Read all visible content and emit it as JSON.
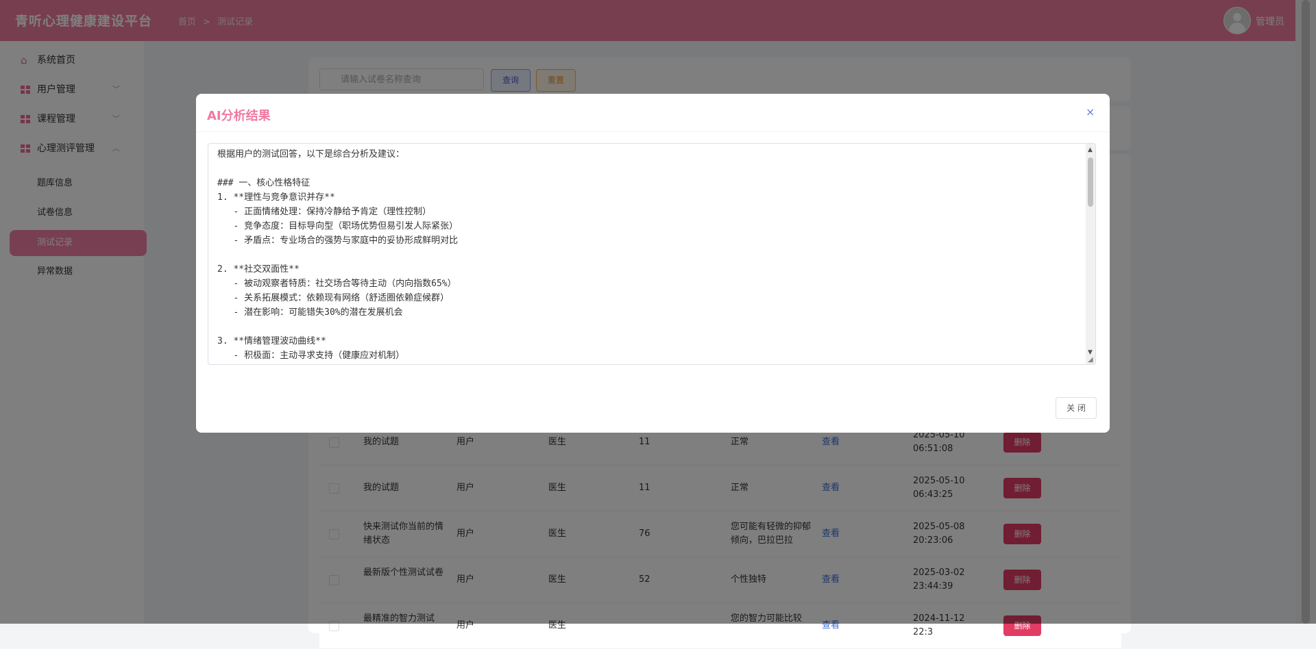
{
  "header": {
    "brand": "青听心理健康建设平台",
    "breadcrumb": [
      "首页",
      "测试记录"
    ],
    "user_name": "管理员"
  },
  "sidebar": {
    "items": [
      {
        "label": "系统首页",
        "icon": "home-icon"
      },
      {
        "label": "用户管理",
        "icon": "grid-icon",
        "chevron": "﹀"
      },
      {
        "label": "课程管理",
        "icon": "grid-icon",
        "chevron": "﹀"
      },
      {
        "label": "心理测评管理",
        "icon": "grid-icon",
        "chevron": "︿"
      }
    ],
    "sub_items": [
      {
        "label": "题库信息"
      },
      {
        "label": "试卷信息"
      },
      {
        "label": "测试记录",
        "active": true
      },
      {
        "label": "异常数据"
      }
    ]
  },
  "search": {
    "placeholder": "请输入试卷名称查询",
    "query_label": "查询",
    "reset_label": "重置"
  },
  "table": {
    "rows": [
      {
        "name": "我的试题",
        "user": "用户",
        "doctor": "医生",
        "score": "11",
        "result": "正常",
        "view": "查看",
        "time": "2025-05-10 06:51:08",
        "delete": "删除"
      },
      {
        "name": "我的试题",
        "user": "用户",
        "doctor": "医生",
        "score": "11",
        "result": "正常",
        "view": "查看",
        "time": "2025-05-10 06:43:25",
        "delete": "删除"
      },
      {
        "name": "快来测试你当前的情绪状态",
        "user": "用户",
        "doctor": "医生",
        "score": "76",
        "result": "您可能有轻微的抑郁倾向，巴拉巴拉",
        "view": "查看",
        "time": "2025-05-08 20:23:06",
        "delete": "删除"
      },
      {
        "name": "最新版个性测试试卷",
        "user": "用户",
        "doctor": "医生",
        "score": "52",
        "result": "个性独特",
        "view": "查看",
        "time": "2025-03-02 23:44:39",
        "delete": "删除"
      },
      {
        "name": "最精准的智力测试",
        "user": "用户",
        "doctor": "医生",
        "score": "",
        "result": "您的智力可能比较",
        "view": "查看",
        "time": "2024-11-12 22:3",
        "delete": "删除"
      }
    ]
  },
  "modal": {
    "title": "AI分析结果",
    "close_icon": "×",
    "content": "根据用户的测试回答，以下是综合分析及建议：\n\n### 一、核心性格特征\n1. **理性与竞争意识并存**\n   - 正面情绪处理：保持冷静给予肯定（理性控制）\n   - 竞争态度：目标导向型（职场优势但易引发人际紧张）\n   - 矛盾点：专业场合的强势与家庭中的妥协形成鲜明对比\n\n2. **社交双面性**\n   - 被动观察者特质：社交场合等待主动（内向指数65%）\n   - 关系拓展模式：依赖现有网络（舒适圈依赖症候群）\n   - 潜在影响：可能错失30%的潜在发展机会\n\n3. **情绪管理波动曲线**\n   - 积极面：主动寻求支持（健康应对机制）\n   - 消极面：挫折易重复刻画不快（自我批判倾向）",
    "close_label": "关 闭"
  }
}
